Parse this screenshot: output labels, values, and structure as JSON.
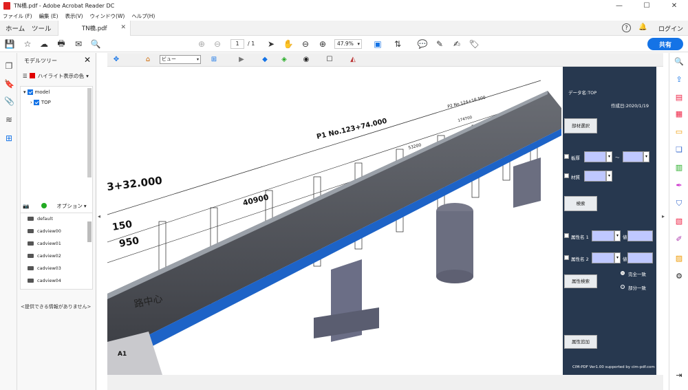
{
  "window": {
    "title": "TN橋.pdf - Adobe Acrobat Reader DC",
    "minimize": "—",
    "maximize": "☐",
    "close": "✕"
  },
  "menu": [
    "ファイル (F)",
    "編集 (E)",
    "表示(V)",
    "ウィンドウ(W)",
    "ヘルプ(H)"
  ],
  "tabs": {
    "home": "ホーム",
    "tools": "ツール",
    "document": "TN橋.pdf",
    "login": "ログイン",
    "help": "?"
  },
  "toolbar": {
    "page_current": "1",
    "page_total": "/ 1",
    "zoom": "47.9%",
    "share": "共有"
  },
  "model_tree": {
    "title": "モデルツリー",
    "highlight_label": "ハイライト表示の色",
    "highlight_color": "#e00000",
    "nodes": [
      "model",
      "TOP"
    ],
    "option_label": "オプション",
    "views": [
      "default",
      "cadview00",
      "cadview01",
      "cadview02",
      "cadview03",
      "cadview04"
    ],
    "info": "<提供できる情報がありません>"
  },
  "view_toolbar": {
    "view_select": "ビュー"
  },
  "drawing": {
    "station_a": "3+32.000",
    "station_p1": "P1 No.123+74.000",
    "station_p2": "P2 No.124+18.500",
    "dim_40900": "40900",
    "dim_150": "150",
    "dim_950": "950",
    "dim_174700": "174700",
    "dim_53200": "53200",
    "road_center": "路中心",
    "abutment": "A1"
  },
  "cim_panel": {
    "data_name": "データ名:TOP",
    "created": "作成日:2020/1/19",
    "member_select": "部材選択",
    "thickness": "板厚",
    "tilde": "～",
    "material": "材質",
    "search": "検索",
    "attr1": "属性名 1",
    "attr2": "属性名 2",
    "value": "値",
    "attr_search": "属性検索",
    "exact": "完全一致",
    "partial": "部分一致",
    "attr_add": "属性追加",
    "footer": "CIM-PDF Ver1.00 supported by cim-pdf.com"
  }
}
